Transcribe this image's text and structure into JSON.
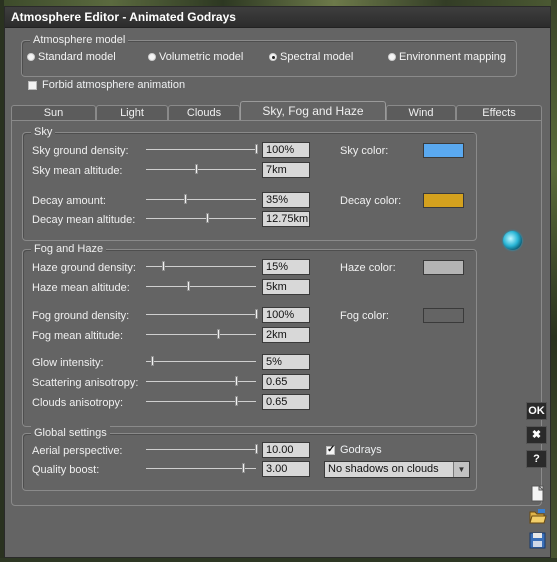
{
  "window": {
    "title": "Atmosphere Editor - Animated Godrays"
  },
  "model": {
    "group_title": "Atmosphere model",
    "options": [
      "Standard model",
      "Volumetric model",
      "Spectral model",
      "Environment mapping"
    ],
    "selected": "Spectral model"
  },
  "forbid_animation": {
    "label": "Forbid atmosphere animation",
    "checked": false
  },
  "tabs": [
    "Sun",
    "Light",
    "Clouds",
    "Sky, Fog and Haze",
    "Wind",
    "Effects"
  ],
  "active_tab": "Sky, Fog and Haze",
  "sky": {
    "title": "Sky",
    "ground_density": {
      "label": "Sky ground density:",
      "value": "100%",
      "slider": 1.0
    },
    "mean_altitude": {
      "label": "Sky mean altitude:",
      "value": "7km",
      "slider": 0.45
    },
    "decay_amount": {
      "label": "Decay amount:",
      "value": "35%",
      "slider": 0.35
    },
    "decay_mean_altitude": {
      "label": "Decay mean altitude:",
      "value": "12.75km",
      "slider": 0.55
    },
    "sky_color": {
      "label": "Sky color:",
      "color": "#5aa9f0"
    },
    "decay_color": {
      "label": "Decay color:",
      "color": "#d4a11e"
    }
  },
  "fog_haze": {
    "title": "Fog and Haze",
    "haze_ground_density": {
      "label": "Haze ground density:",
      "value": "15%",
      "slider": 0.15
    },
    "haze_mean_altitude": {
      "label": "Haze mean altitude:",
      "value": "5km",
      "slider": 0.38
    },
    "fog_ground_density": {
      "label": "Fog ground density:",
      "value": "100%",
      "slider": 1.0
    },
    "fog_mean_altitude": {
      "label": "Fog mean altitude:",
      "value": "2km",
      "slider": 0.65
    },
    "glow_intensity": {
      "label": "Glow intensity:",
      "value": "5%",
      "slider": 0.05
    },
    "scattering_anisotropy": {
      "label": "Scattering anisotropy:",
      "value": "0.65",
      "slider": 0.82
    },
    "clouds_anisotropy": {
      "label": "Clouds anisotropy:",
      "value": "0.65",
      "slider": 0.82
    },
    "haze_color": {
      "label": "Haze color:",
      "color": "#b4b4b4"
    },
    "fog_color": {
      "label": "Fog color:",
      "color": "#646464"
    }
  },
  "global": {
    "title": "Global settings",
    "aerial_perspective": {
      "label": "Aerial perspective:",
      "value": "10.00",
      "slider": 1.0
    },
    "quality_boost": {
      "label": "Quality boost:",
      "value": "3.00",
      "slider": 0.88
    },
    "godrays": {
      "label": "Godrays",
      "checked": true
    },
    "shadows": {
      "selected": "No shadows on clouds"
    }
  },
  "side_buttons": {
    "ok": "OK",
    "close": "✖",
    "help": "?"
  },
  "icons": {
    "globe": "globe-icon",
    "new": "new-file-icon",
    "open": "open-folder-icon",
    "save": "save-disk-icon",
    "dropdown": "chevron-down-icon"
  }
}
